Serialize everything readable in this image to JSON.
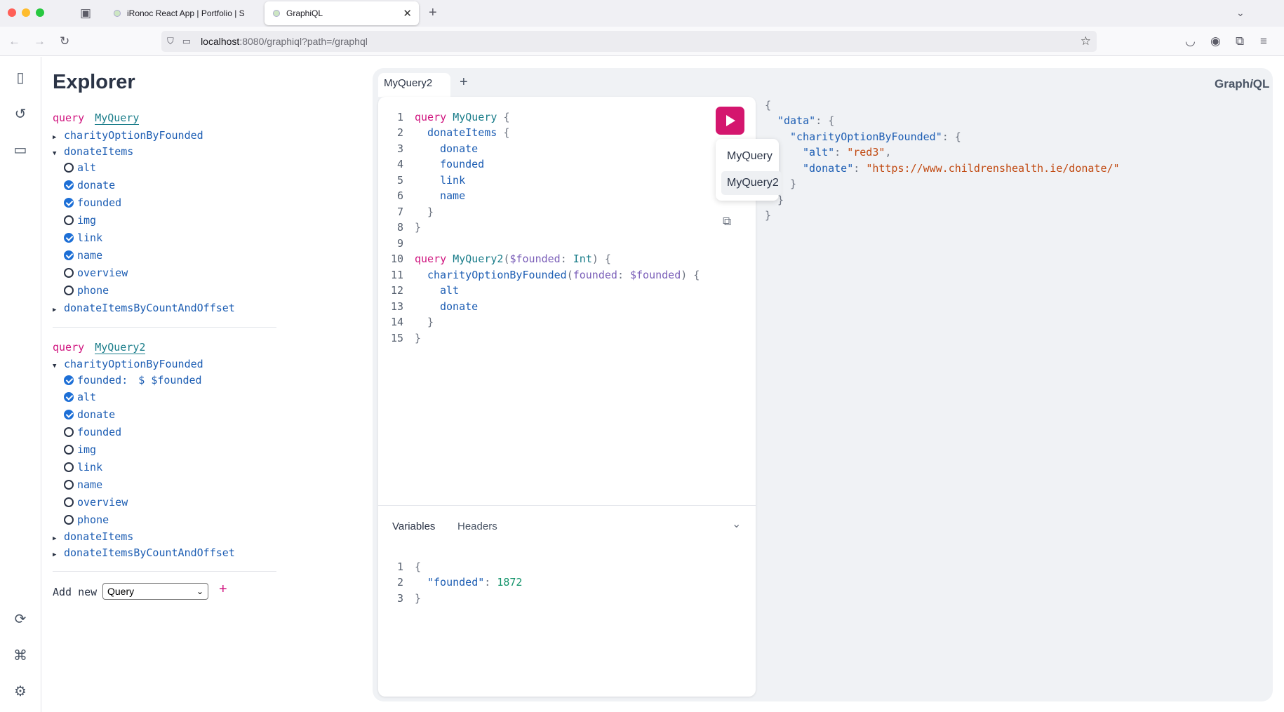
{
  "browser": {
    "tabs": [
      {
        "title": "iRonoc React App | Portfolio | S"
      },
      {
        "title": "GraphiQL"
      }
    ],
    "url_host": "localhost",
    "url_path": ":8080/graphiql?path=/graphql"
  },
  "explorer": {
    "title": "Explorer",
    "query1": {
      "keyword": "query",
      "name": "MyQuery",
      "root_fields": [
        {
          "name": "charityOptionByFounded",
          "expanded": false
        },
        {
          "name": "donateItems",
          "expanded": true
        },
        {
          "name": "donateItemsByCountAndOffset",
          "expanded": false
        }
      ],
      "donateItems_fields": [
        {
          "name": "alt",
          "checked": false
        },
        {
          "name": "donate",
          "checked": true
        },
        {
          "name": "founded",
          "checked": true
        },
        {
          "name": "img",
          "checked": false
        },
        {
          "name": "link",
          "checked": true
        },
        {
          "name": "name",
          "checked": true
        },
        {
          "name": "overview",
          "checked": false
        },
        {
          "name": "phone",
          "checked": false
        }
      ]
    },
    "query2": {
      "keyword": "query",
      "name": "MyQuery2",
      "root_field": "charityOptionByFounded",
      "arg_label": "founded:",
      "arg_value": "$ $founded",
      "fields": [
        {
          "name": "alt",
          "checked": true
        },
        {
          "name": "donate",
          "checked": true
        },
        {
          "name": "founded",
          "checked": false
        },
        {
          "name": "img",
          "checked": false
        },
        {
          "name": "link",
          "checked": false
        },
        {
          "name": "name",
          "checked": false
        },
        {
          "name": "overview",
          "checked": false
        },
        {
          "name": "phone",
          "checked": false
        }
      ],
      "other_fields": [
        "donateItems",
        "donateItemsByCountAndOffset"
      ]
    },
    "add_new_label": "Add new",
    "add_new_value": "Query",
    "add_plus": "+"
  },
  "graphiql": {
    "brand": "GraphiQL",
    "brand_emph": "i",
    "editor_tab": "MyQuery2",
    "add_tab": "+",
    "line_numbers": [
      "1",
      "2",
      "3",
      "4",
      "5",
      "6",
      "7",
      "8",
      "9",
      "10",
      "11",
      "12",
      "13",
      "14",
      "15"
    ],
    "code": {
      "l1_kw": "query",
      "l1_name": "MyQuery",
      "l1_brace": "{",
      "l2_field": "donateItems",
      "l2_brace": "{",
      "l3": "donate",
      "l4": "founded",
      "l5": "link",
      "l6": "name",
      "l7": "}",
      "l8": "}",
      "l10_kw": "query",
      "l10_name": "MyQuery2",
      "l10_var": "$founded",
      "l10_colon": ":",
      "l10_type": "Int",
      "l10_end": ") {",
      "l11_field": "charityOptionByFounded",
      "l11_arg": "founded",
      "l11_var": "$founded",
      "l11_end": ") {",
      "l12": "alt",
      "l13": "donate",
      "l14": "}",
      "l15": "}"
    },
    "operations": [
      "MyQuery",
      "MyQuery2"
    ],
    "vars_tabs": [
      "Variables",
      "Headers"
    ],
    "vars_line_numbers": [
      "1",
      "2",
      "3"
    ],
    "vars_key": "\"founded\"",
    "vars_value": "1872",
    "result": {
      "data_key": "\"data\"",
      "field_key": "\"charityOptionByFounded\"",
      "alt_key": "\"alt\"",
      "alt_val": "\"red3\"",
      "donate_key": "\"donate\"",
      "donate_val": "\"https://www.childrenshealth.ie/donate/\""
    }
  },
  "colors": {
    "keyword": "#d0157f",
    "field": "#1c5db3",
    "run_button": "#d4166e",
    "checkbox_on": "#1d6fd6"
  }
}
